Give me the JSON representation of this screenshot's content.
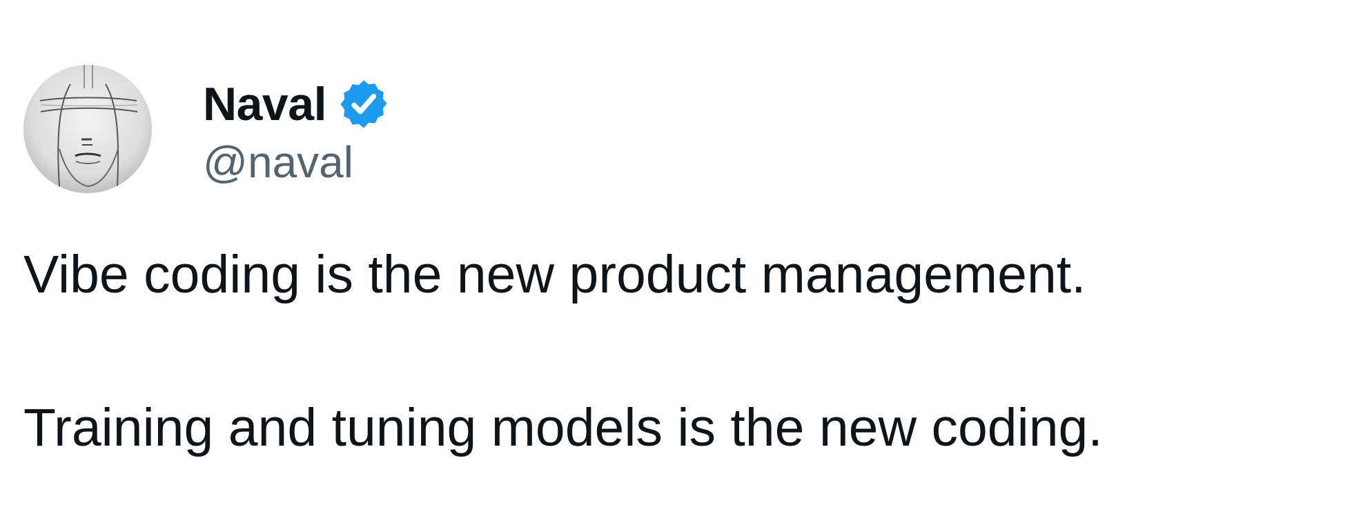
{
  "author": {
    "display_name": "Naval",
    "handle": "@naval",
    "verified": true,
    "verified_icon": "verified-badge-icon",
    "avatar": "pencil-sketch-face-avatar"
  },
  "tweet": {
    "lines": [
      "Vibe coding is the new product management.",
      "Training and tuning models is the new coding."
    ]
  },
  "colors": {
    "text": "#0f1419",
    "secondary_text": "#536471",
    "verified_blue": "#1d9bf0",
    "background": "#ffffff"
  }
}
